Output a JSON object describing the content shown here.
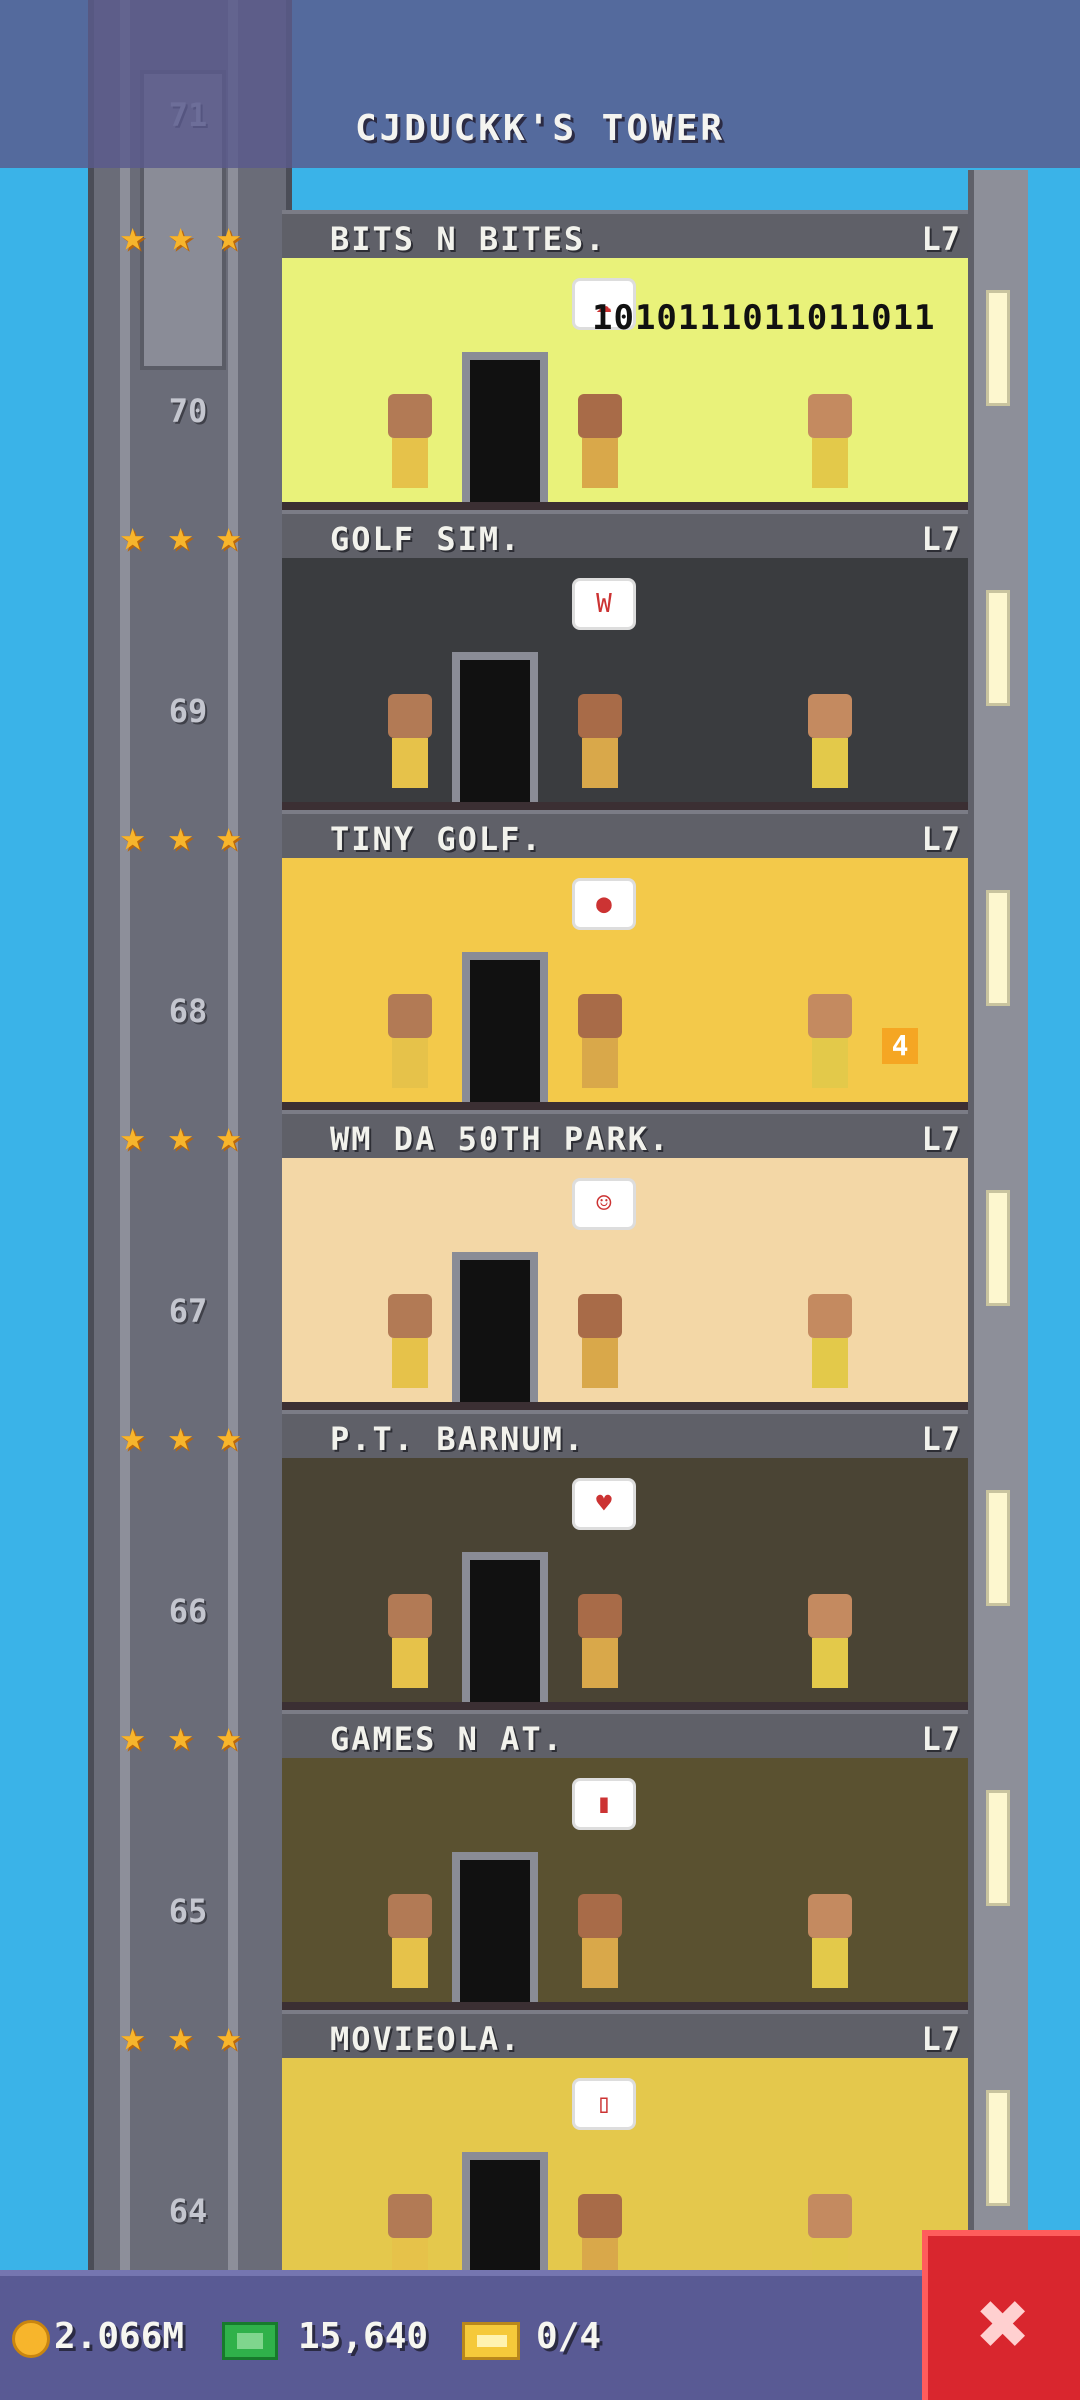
{
  "header": {
    "title": "CJDUCKK'S TOWER"
  },
  "top_floor_number": "71",
  "floors": [
    {
      "name": "BITS N BITES.",
      "level": "L7",
      "number": "70",
      "stars": 3,
      "wall_color": "#e9f27a",
      "extra_text": "1010111011011011",
      "bubble": "☁"
    },
    {
      "name": "GOLF SIM.",
      "level": "L7",
      "number": "69",
      "stars": 3,
      "wall_color": "#3a3c3f",
      "bubble": "W"
    },
    {
      "name": "TINY GOLF.",
      "level": "L7",
      "number": "68",
      "stars": 3,
      "wall_color": "#f3c94a",
      "bubble": "●",
      "sign": "4"
    },
    {
      "name": "WM DA 50TH PARK.",
      "level": "L7",
      "number": "67",
      "stars": 3,
      "wall_color": "#f3d7a6",
      "bubble": "☺"
    },
    {
      "name": "P.T. BARNUM.",
      "level": "L7",
      "number": "66",
      "stars": 3,
      "wall_color": "#4a4434",
      "bubble": "♥"
    },
    {
      "name": "GAMES N AT.",
      "level": "L7",
      "number": "65",
      "stars": 3,
      "wall_color": "#5a5130",
      "bubble": "▮"
    },
    {
      "name": "MOVIEOLA.",
      "level": "L7",
      "number": "64",
      "stars": 3,
      "wall_color": "#e4c84c",
      "bubble": "▯"
    }
  ],
  "bottom_bar": {
    "coins": "2.066M",
    "bux": "15,640",
    "tickets": "0/4"
  },
  "icons": {
    "coin": "coin-icon",
    "bux": "bux-icon",
    "ticket": "ticket-icon",
    "star": "star-icon",
    "close": "close-icon"
  },
  "colors": {
    "sky": "#3ab3e8",
    "header": "#5a5a8c",
    "close_button": "#d9262e",
    "star": "#f7b52c"
  }
}
